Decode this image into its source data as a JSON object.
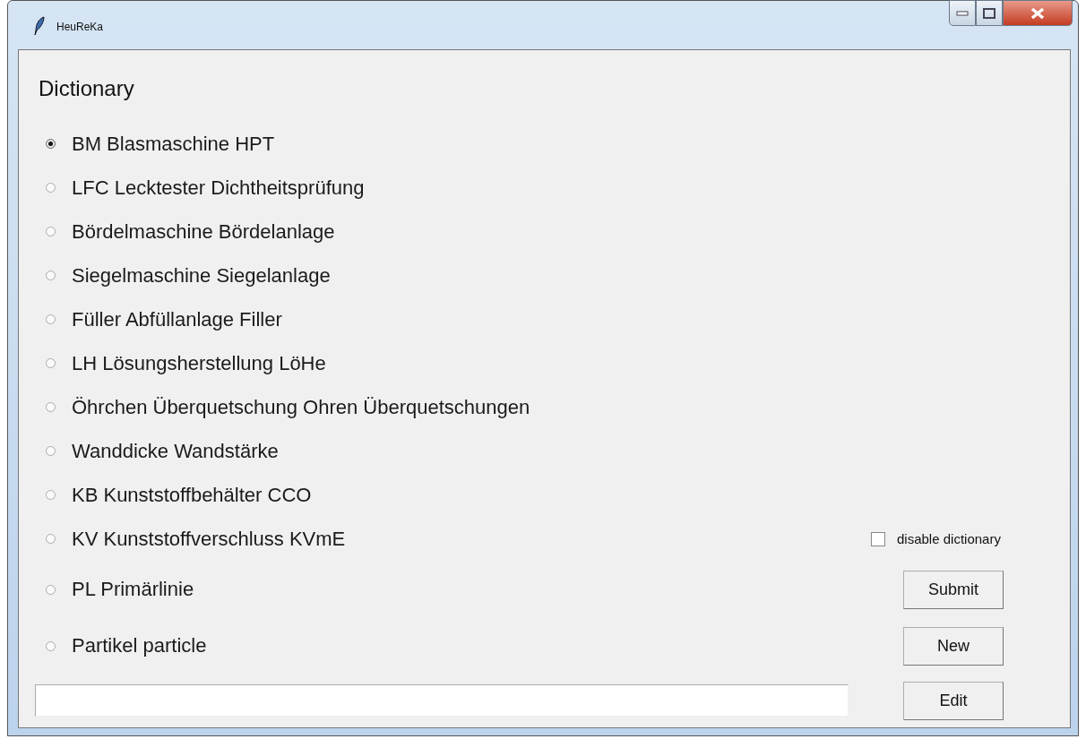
{
  "window": {
    "title": "HeuReKa"
  },
  "heading": "Dictionary",
  "options": [
    {
      "label": "BM Blasmaschine HPT",
      "selected": true
    },
    {
      "label": "LFC Lecktester Dichtheitsprüfung",
      "selected": false
    },
    {
      "label": "Bördelmaschine Bördelanlage",
      "selected": false
    },
    {
      "label": "Siegelmaschine Siegelanlage",
      "selected": false
    },
    {
      "label": "Füller Abfüllanlage Filler",
      "selected": false
    },
    {
      "label": "LH Lösungsherstellung LöHe",
      "selected": false
    },
    {
      "label": "Öhrchen Überquetschung Ohren Überquetschungen",
      "selected": false
    },
    {
      "label": "Wanddicke Wandstärke",
      "selected": false
    },
    {
      "label": "KB Kunststoffbehälter CCO",
      "selected": false
    },
    {
      "label": "KV Kunststoffverschluss KVmE",
      "selected": false
    },
    {
      "label": "PL Primärlinie",
      "selected": false
    },
    {
      "label": "Partikel particle",
      "selected": false
    }
  ],
  "checkbox": {
    "label": "disable dictionary",
    "checked": false
  },
  "buttons": [
    "Submit",
    "New",
    "Edit"
  ]
}
